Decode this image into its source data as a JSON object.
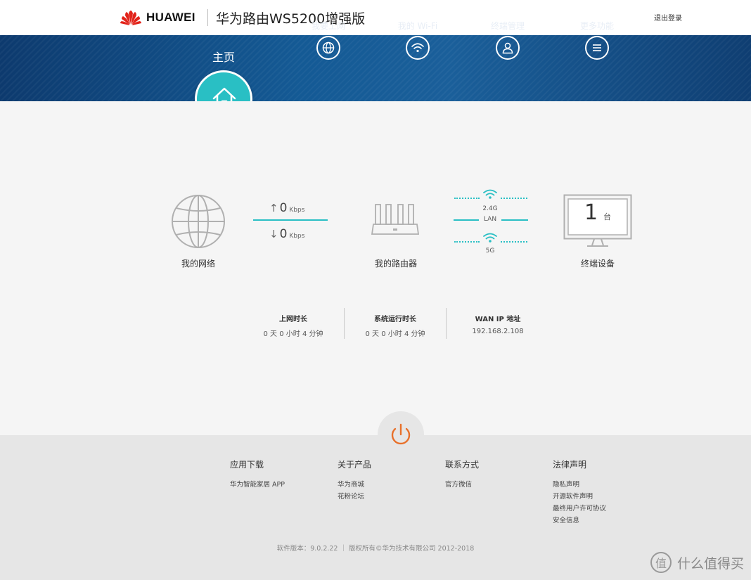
{
  "header": {
    "brand": "HUAWEI",
    "product_title": "华为路由WS5200增强版",
    "logout": "退出登录"
  },
  "nav": {
    "home": "主页",
    "items": [
      {
        "label": "我要上网",
        "icon": "globe-icon"
      },
      {
        "label": "我的 Wi-Fi",
        "icon": "wifi-icon"
      },
      {
        "label": "终端管理",
        "icon": "user-icon"
      },
      {
        "label": "更多功能",
        "icon": "menu-icon"
      }
    ]
  },
  "topology": {
    "network_label": "我的网络",
    "upload_value": "0",
    "download_value": "0",
    "speed_unit": "Kbps",
    "router_label": "我的路由器",
    "band_24": "2.4G",
    "band_lan": "LAN",
    "band_5": "5G",
    "device_count": "1",
    "device_unit": "台",
    "devices_label": "终端设备"
  },
  "stats": [
    {
      "title": "上网时长",
      "value": "0 天 0 小时 4 分钟"
    },
    {
      "title": "系统运行时长",
      "value": "0 天 0 小时 4 分钟"
    },
    {
      "title": "WAN IP 地址",
      "value": "192.168.2.108"
    }
  ],
  "footer": {
    "columns": [
      {
        "title": "应用下载",
        "links": [
          "华为智能家居 APP"
        ]
      },
      {
        "title": "关于产品",
        "links": [
          "华为商城",
          "花粉论坛"
        ]
      },
      {
        "title": "联系方式",
        "links": [
          "官方微信"
        ]
      },
      {
        "title": "法律声明",
        "links": [
          "隐私声明",
          "开源软件声明",
          "最终用户许可协议",
          "安全信息"
        ]
      }
    ],
    "copyright": "软件版本：9.0.2.22 ｜ 版权所有©华为技术有限公司 2012-2018"
  },
  "watermark": {
    "mark": "值",
    "text": "什么值得买"
  },
  "colors": {
    "accent": "#29bfc4",
    "nav_band": "#145a95",
    "power": "#e8702a"
  }
}
